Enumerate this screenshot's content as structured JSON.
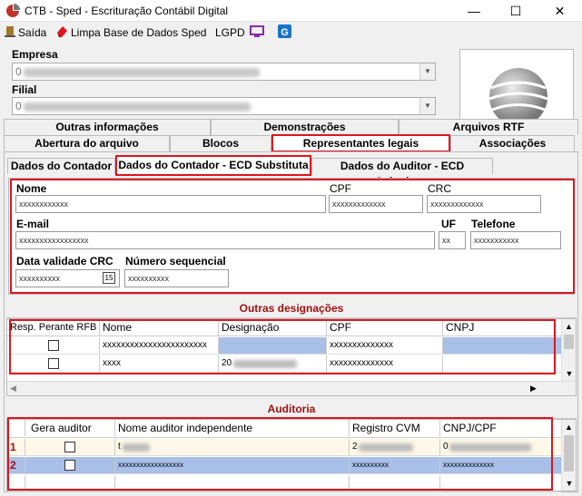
{
  "window": {
    "title": "CTB - Sped - Escrituração Contábil Digital"
  },
  "menu": {
    "exit": "Saída",
    "clean": "Limpa Base de Dados Sped",
    "lgpd": "LGPD"
  },
  "empresa": {
    "label": "Empresa",
    "value": "0"
  },
  "filial": {
    "label": "Filial",
    "value": "0"
  },
  "tabs_row1": [
    "Outras informações",
    "Demonstrações",
    "Arquivos RTF"
  ],
  "tabs_row2": [
    "Abertura do arquivo",
    "Blocos",
    "Representantes legais",
    "Associações"
  ],
  "subtabs": [
    "Dados do Contador",
    "Dados do Contador - ECD Substituta",
    "Dados do Auditor - ECD Substituta"
  ],
  "form": {
    "nome_label": "Nome",
    "nome_value": "xxxxxxxxxxxx",
    "cpf_label": "CPF",
    "cpf_value": "xxxxxxxxxxxxx",
    "crc_label": "CRC",
    "crc_value": "xxxxxxxxxxxxx",
    "email_label": "E-mail",
    "email_value": "xxxxxxxxxxxxxxxxx",
    "uf_label": "UF",
    "uf_value": "xx",
    "tel_label": "Telefone",
    "tel_value": "xxxxxxxxxxx",
    "crcdate_label": "Data validade CRC",
    "crcdate_value": "xxxxxxxxxx",
    "cal_icon": "15",
    "seq_label": "Número sequencial",
    "seq_value": "xxxxxxxxxx"
  },
  "outras": {
    "title": "Outras designações",
    "columns": [
      "Resp. Perante RFB",
      "Nome",
      "Designação",
      "CPF",
      "CNPJ"
    ],
    "rows": [
      {
        "nome": "xxxxxxxxxxxxxxxxxxxxxxx",
        "designacao": "",
        "cpf": "xxxxxxxxxxxxxx"
      },
      {
        "nome": "xxxx",
        "designacao": "20",
        "cpf": "xxxxxxxxxxxxxx"
      }
    ]
  },
  "auditoria": {
    "title": "Auditoria",
    "columns": [
      "Gera auditor",
      "Nome auditor independente",
      "Registro CVM",
      "CNPJ/CPF"
    ],
    "rows": [
      {
        "num": "1",
        "nome": "t",
        "registro": "2",
        "cnpj": "0"
      },
      {
        "num": "2",
        "nome": "xxxxxxxxxxxxxxxxxx",
        "registro": "xxxxxxxxxx",
        "cnpj": "xxxxxxxxxxxxxx"
      }
    ]
  },
  "colors": {
    "accent_red": "#e0141e",
    "selected_row": "#a8bfe8",
    "header_red": "#a01010"
  }
}
